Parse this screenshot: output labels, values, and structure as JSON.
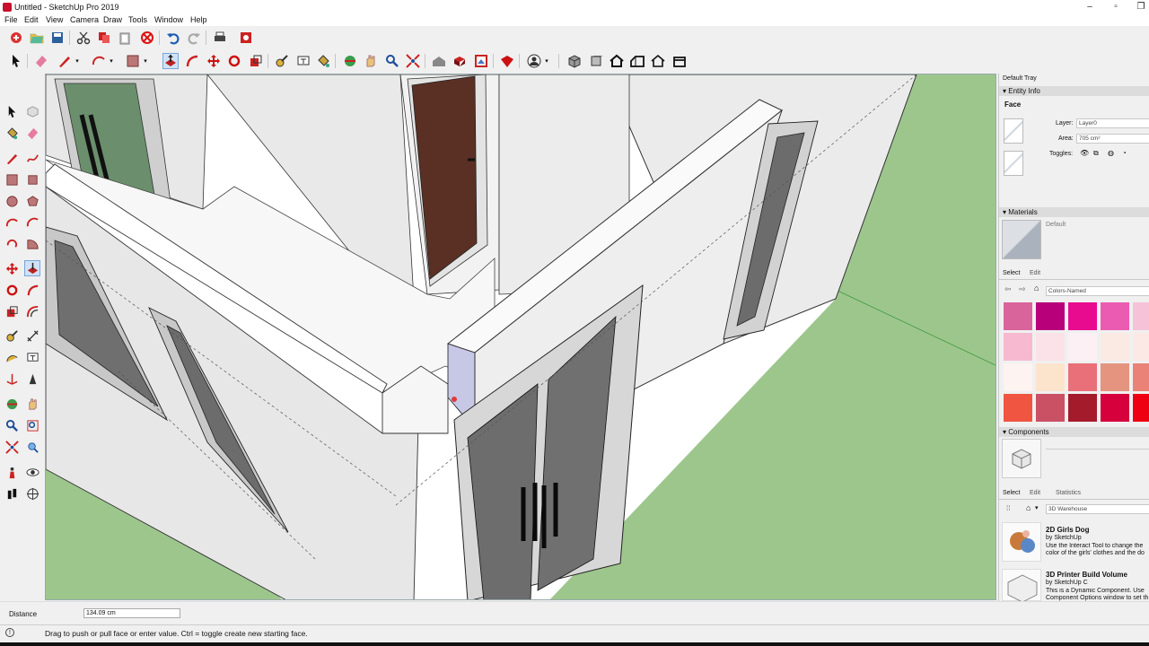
{
  "window": {
    "title": "Untitled - SketchUp Pro 2019"
  },
  "menu": [
    "File",
    "Edit",
    "View",
    "Camera",
    "Draw",
    "Tools",
    "Window",
    "Help"
  ],
  "tray": {
    "title": "Default Tray",
    "entity_info": {
      "header": "Entity Info",
      "type": "Face",
      "layer_label": "Layer:",
      "layer_value": "Layer0",
      "area_label": "Area:",
      "area_value": "705 cm²",
      "toggles_label": "Toggles:"
    },
    "materials": {
      "header": "Materials",
      "current": "Default",
      "tab_select": "Select",
      "tab_edit": "Edit",
      "library": "Colors-Named",
      "swatches": [
        "#d9649b",
        "#b8007a",
        "#e80a8f",
        "#ec5bb2",
        "#f6c2d8",
        "#f7b9cf",
        "#fbe1e8",
        "#fdf0f4",
        "#fbe9e4",
        "#fce8e5",
        "#fdf3f1",
        "#fce4cc",
        "#e97079",
        "#e59480",
        "#ea8277",
        "#ef5540",
        "#c95163",
        "#a41b2c",
        "#d6003c",
        "#ee0012"
      ]
    },
    "components": {
      "header": "Components",
      "tab_select": "Select",
      "tab_edit": "Edit",
      "tab_statistics": "Statistics",
      "search_placeholder": "3D Warehouse",
      "items": [
        {
          "name": "2D Girls Dog",
          "author": "by SketchUp",
          "desc": "Use the Interact Tool to change the color of the girls' clothes and the do"
        },
        {
          "name": "3D Printer Build Volume",
          "author": "by SketchUp C",
          "desc": "This is a Dynamic Component. Use Component Options window to set th"
        }
      ]
    }
  },
  "measurements": {
    "label": "Distance",
    "value": "134.09 cm"
  },
  "status": {
    "message": "Drag to push or pull face or enter value.  Ctrl = toggle create new starting face."
  }
}
